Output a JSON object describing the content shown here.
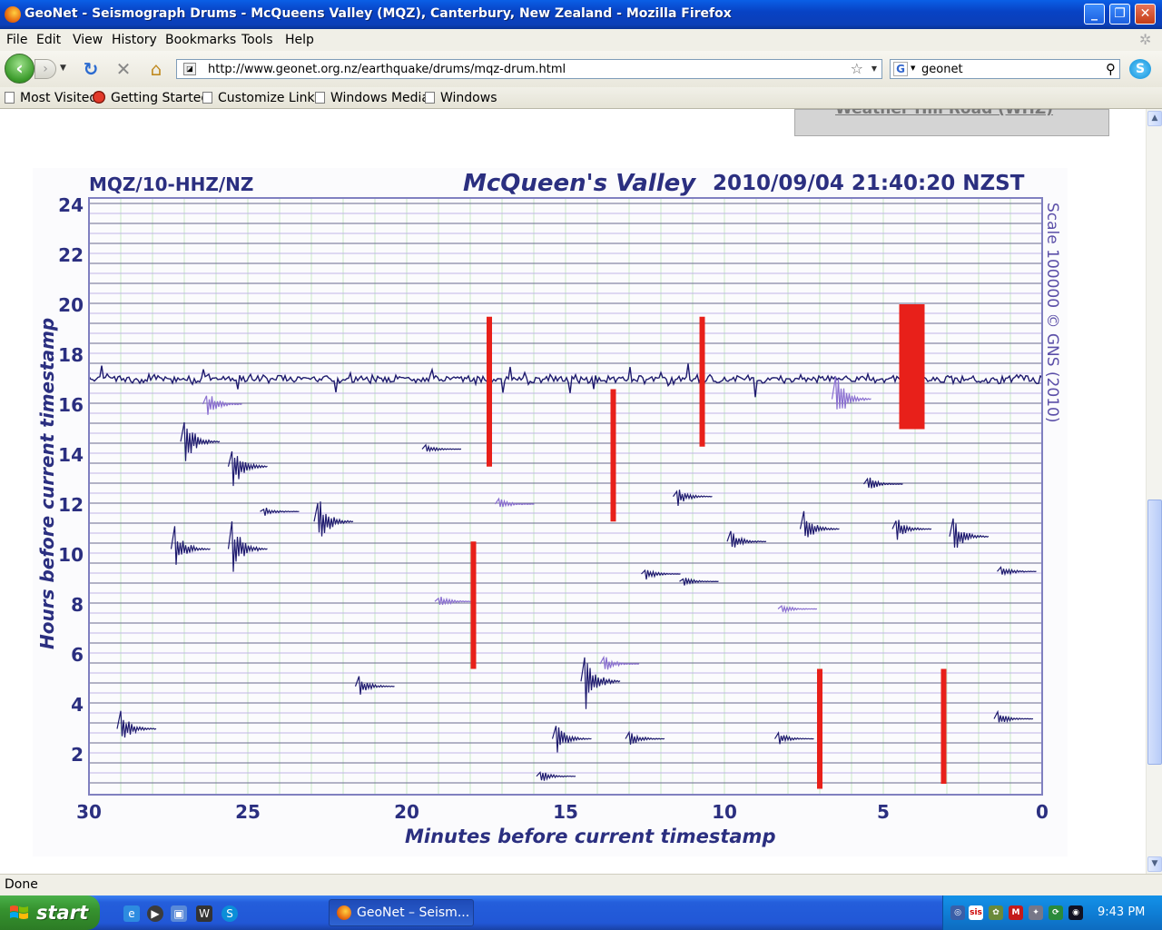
{
  "window": {
    "title": "GeoNet - Seismograph Drums - McQueens Valley (MQZ), Canterbury, New Zealand - Mozilla Firefox",
    "minimize_label": "_",
    "maximize_label": "❐",
    "close_label": "✕"
  },
  "menu": {
    "items": [
      "File",
      "Edit",
      "View",
      "History",
      "Bookmarks",
      "Tools",
      "Help"
    ]
  },
  "navigation": {
    "url": "http://www.geonet.org.nz/earthquake/drums/mqz-drum.html",
    "search_value": "geonet",
    "search_engine_icon": "G"
  },
  "bookmarks": {
    "items": [
      "Most Visited",
      "Getting Started",
      "Customize Links",
      "Windows Media",
      "Windows"
    ]
  },
  "page": {
    "partial_link": "Weather Hill Road (WHZ)"
  },
  "drum": {
    "station_code": "MQZ/10-HHZ/NZ",
    "station_name": "McQueen's Valley",
    "timestamp": "2010/09/04 21:40:20 NZST",
    "scale_note": "Scale 100000 © GNS (2010)",
    "y_axis_label": "Hours before current timestamp",
    "x_axis_label": "Minutes before current timestamp",
    "y_ticks": [
      "24",
      "22",
      "20",
      "18",
      "16",
      "14",
      "12",
      "10",
      "8",
      "6",
      "4",
      "2"
    ],
    "x_ticks": [
      "30",
      "25",
      "20",
      "15",
      "10",
      "5",
      "0"
    ],
    "colors": {
      "trace_dark": "#1e1a6e",
      "trace_light": "#8a6fd0",
      "large_event": "#e8201a",
      "frame": "#8080c0",
      "grid_minor": "#c8e8c8",
      "label": "#2b2f80"
    }
  },
  "status": {
    "text": "Done"
  },
  "taskbar": {
    "start_label": "start",
    "task_label": "GeoNet – Seism...",
    "clock": "9:43 PM"
  }
}
